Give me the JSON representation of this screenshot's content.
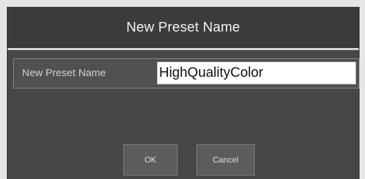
{
  "dialog": {
    "title": "New Preset Name",
    "field_label": "New Preset Name",
    "field_value": "HighQualityColor",
    "ok_label": "OK",
    "cancel_label": "Cancel"
  },
  "colors": {
    "page_background": "#e6e6e6",
    "dialog_background": "#474747",
    "title_bar_background": "#3b3b3b",
    "button_background": "#5c5c5c",
    "text_light": "#f2f2f2"
  }
}
